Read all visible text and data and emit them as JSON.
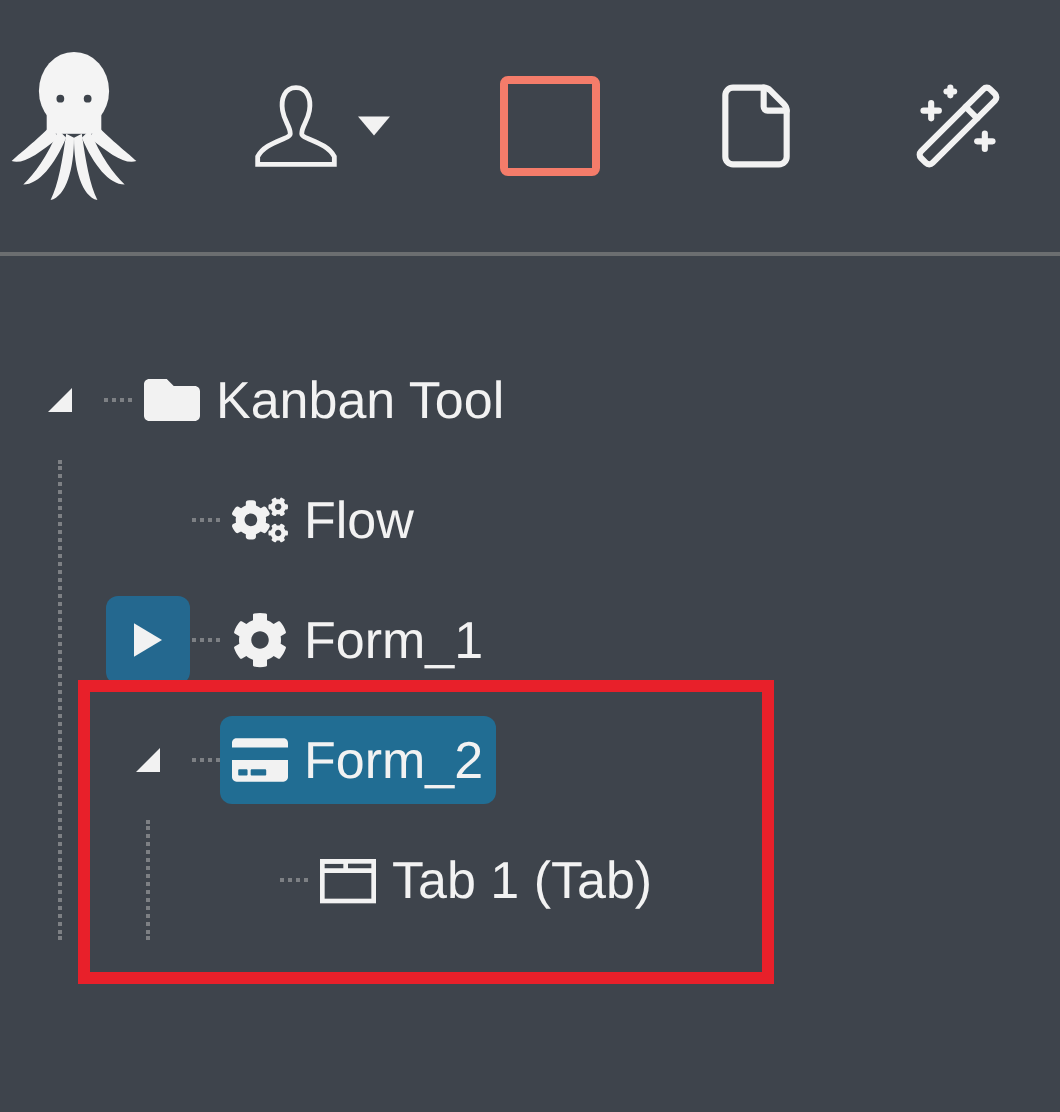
{
  "tree": [
    {
      "label": "Kanban Tool",
      "kind": "folder",
      "expanded": true,
      "selected": false,
      "highlighted": false,
      "children": [
        {
          "label": "Flow",
          "kind": "flow",
          "selected": false,
          "highlighted": false
        },
        {
          "label": "Form_1",
          "kind": "form",
          "expanded": false,
          "selected": false,
          "highlighted": false
        },
        {
          "label": "Form_2",
          "kind": "card",
          "expanded": true,
          "selected": true,
          "highlighted": true,
          "children": [
            {
              "label": "Tab 1 (Tab)",
              "kind": "tab",
              "selected": false,
              "highlighted": false
            }
          ]
        }
      ]
    }
  ]
}
